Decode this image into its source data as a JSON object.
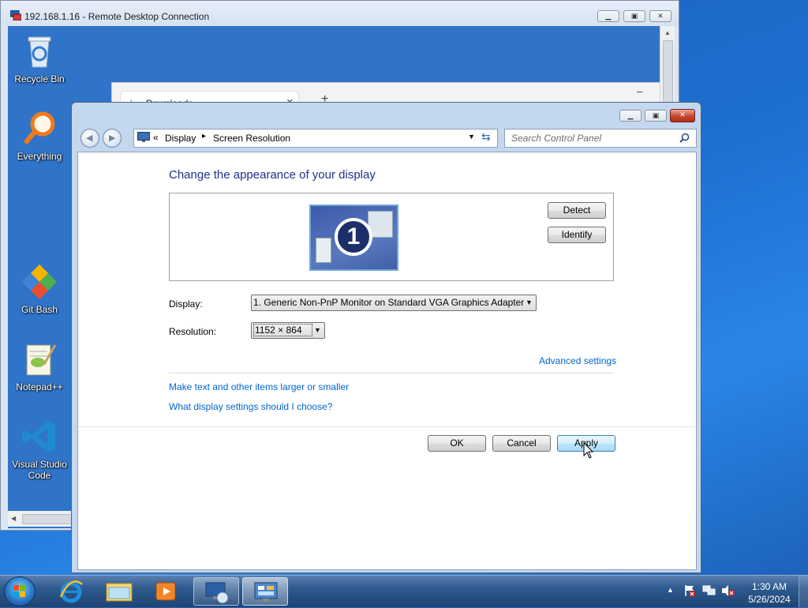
{
  "rdc": {
    "title": "192.168.1.16 - Remote Desktop Connection",
    "minimize_icon": "minimize-icon",
    "restore_icon": "restore-icon",
    "close_icon": "close-icon"
  },
  "remote_desktop": {
    "icons": [
      {
        "label": "Recycle Bin",
        "icon": "recycle-bin-icon"
      },
      {
        "label": "Everything",
        "icon": "everything-search-icon"
      },
      {
        "label": "Git Bash",
        "icon": "git-bash-icon"
      },
      {
        "label": "Notepad++",
        "icon": "notepad-plus-plus-icon"
      },
      {
        "label": "Visual Studio Code",
        "icon": "vscode-icon"
      }
    ],
    "browser": {
      "tab_title": "Downloads",
      "close": "×",
      "new_tab": "+",
      "minimize": "–"
    }
  },
  "dialog": {
    "breadcrumb": {
      "prefix": "«",
      "item1": "Display",
      "sep": "▸",
      "item2": "Screen Resolution"
    },
    "search_placeholder": "Search Control Panel",
    "heading": "Change the appearance of your display",
    "monitor_number": "1",
    "detect_label": "Detect",
    "identify_label": "Identify",
    "display_label": "Display:",
    "display_value": "1. Generic Non-PnP Monitor on Standard VGA Graphics Adapter",
    "resolution_label": "Resolution:",
    "resolution_value": "1152 × 864",
    "advanced_settings": "Advanced settings",
    "link_text_size": "Make text and other items larger or smaller",
    "link_what_settings": "What display settings should I choose?",
    "ok_label": "OK",
    "cancel_label": "Cancel",
    "apply_label": "Apply"
  },
  "taskbar": {
    "items": [
      {
        "name": "start-button",
        "icon": "windows-orb-icon"
      },
      {
        "name": "internet-explorer",
        "icon": "internet-explorer-icon"
      },
      {
        "name": "windows-explorer",
        "icon": "folder-icon"
      },
      {
        "name": "media-player",
        "icon": "media-player-icon"
      },
      {
        "name": "remote-desktop",
        "icon": "remote-desktop-icon"
      },
      {
        "name": "control-panel",
        "icon": "control-panel-icon"
      }
    ],
    "time": "1:30 AM",
    "date": "5/26/2024",
    "tray_expand": "▲"
  },
  "colors": {
    "link": "#0066cc",
    "heading": "#1e3287",
    "wallpaper": "#1e6fd0"
  }
}
